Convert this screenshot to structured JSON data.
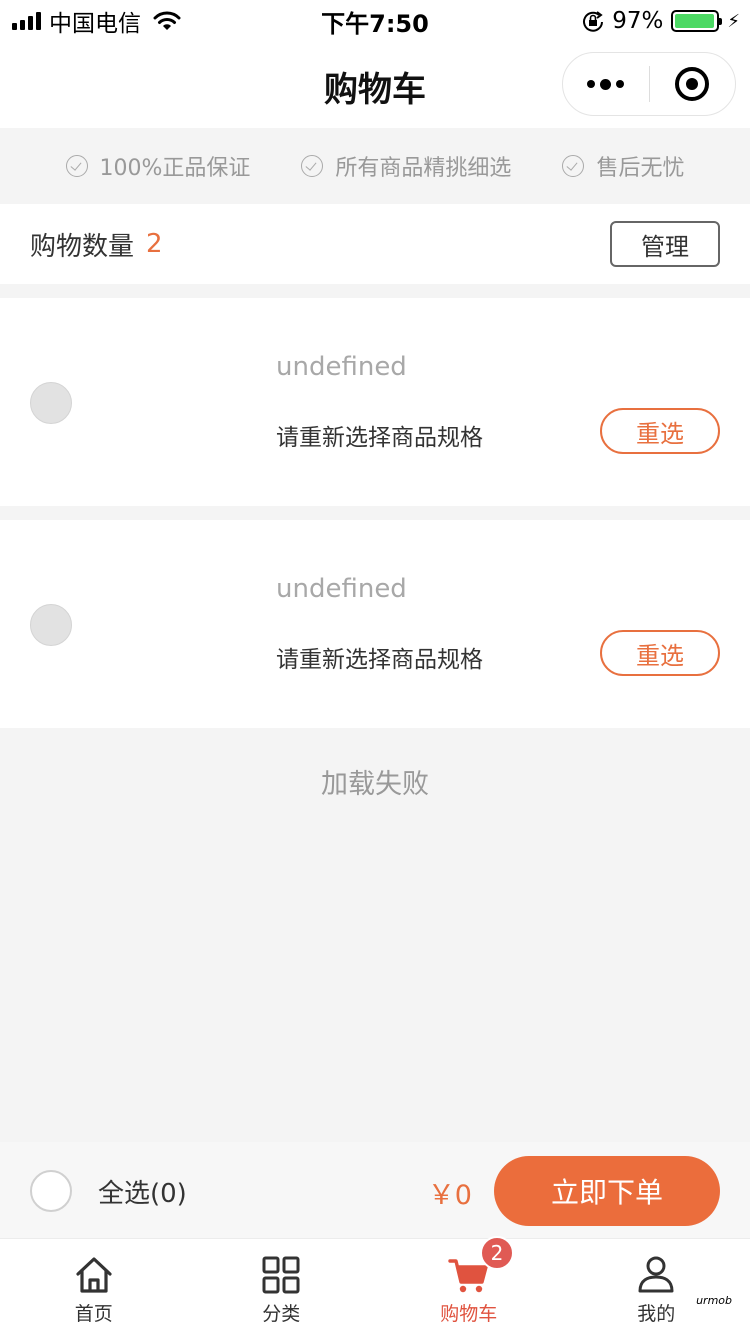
{
  "status_bar": {
    "carrier": "中国电信",
    "time": "下午7:50",
    "battery_percent": "97%",
    "battery_level": 0.97,
    "icons": [
      "signal-icon",
      "wifi-icon",
      "orientation-lock-icon",
      "battery-icon",
      "charging-bolt-icon"
    ]
  },
  "nav": {
    "title": "购物车",
    "more_icon": "more-dots-icon",
    "close_icon": "miniprogram-close-icon"
  },
  "guarantees": [
    {
      "label": "100%正品保证",
      "icon": "check-circle-icon"
    },
    {
      "label": "所有商品精挑细选",
      "icon": "check-circle-icon"
    },
    {
      "label": "售后无忧",
      "icon": "check-circle-icon"
    }
  ],
  "cart_header": {
    "count_label": "购物数量",
    "count": "2",
    "manage_label": "管理"
  },
  "items": [
    {
      "name": "undefined",
      "spec_note": "请重新选择商品规格",
      "reselect_label": "重选",
      "checked": false
    },
    {
      "name": "undefined",
      "spec_note": "请重新选择商品规格",
      "reselect_label": "重选",
      "checked": false
    }
  ],
  "load_status": "加载失败",
  "action_bar": {
    "select_all_label": "全选(0)",
    "total": "￥0",
    "order_label": "立即下单"
  },
  "tabs": [
    {
      "label": "首页",
      "icon": "home-icon",
      "active": false
    },
    {
      "label": "分类",
      "icon": "category-grid-icon",
      "active": false
    },
    {
      "label": "购物车",
      "icon": "cart-icon",
      "active": true,
      "badge": "2"
    },
    {
      "label": "我的",
      "icon": "user-icon",
      "active": false
    }
  ],
  "colors": {
    "accent": "#eb6d3c",
    "price": "#e8703f",
    "tab_active": "#e0533f",
    "badge": "#e05a54",
    "background": "#f4f4f4"
  },
  "watermark": "urmob"
}
